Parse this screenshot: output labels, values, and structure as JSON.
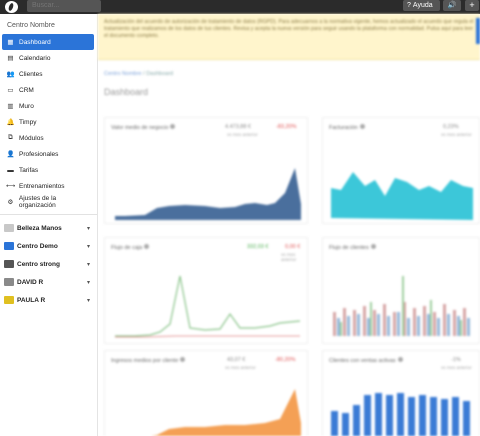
{
  "topbar": {
    "search_placeholder": "Buscar...",
    "help_label": "Ayuda",
    "sound_icon": "volume-icon",
    "plus_label": "+"
  },
  "sidebar": {
    "org_title": "Centro Nombre",
    "items": [
      {
        "label": "Dashboard",
        "icon": "dashboard-icon",
        "glyph": "▦",
        "active": true
      },
      {
        "label": "Calendario",
        "icon": "calendar-icon",
        "glyph": "▤"
      },
      {
        "label": "Clientes",
        "icon": "users-icon",
        "glyph": "👥"
      },
      {
        "label": "CRM",
        "icon": "crm-icon",
        "glyph": "▭"
      },
      {
        "label": "Muro",
        "icon": "wall-icon",
        "glyph": "▥"
      },
      {
        "label": "Timpy",
        "icon": "bell-icon",
        "glyph": "🔔"
      },
      {
        "label": "Módulos",
        "icon": "modules-icon",
        "glyph": "⧉"
      },
      {
        "label": "Profesionales",
        "icon": "professionals-icon",
        "glyph": "👤"
      },
      {
        "label": "Tarifas",
        "icon": "rates-icon",
        "glyph": "▬"
      },
      {
        "label": "Entrenamientos",
        "icon": "training-icon",
        "glyph": "⟷"
      },
      {
        "label": "Ajustes de la organización",
        "icon": "gear-icon",
        "glyph": "⚙"
      }
    ],
    "centers": [
      {
        "label": "Belleza Manos",
        "color": "#c8c8c8"
      },
      {
        "label": "Centro Demo",
        "color": "#2b74d8"
      },
      {
        "label": "Centro strong",
        "color": "#555555"
      },
      {
        "label": "DAVID R",
        "color": "#8a8a8a"
      },
      {
        "label": "PAULA R",
        "color": "#e0c020"
      }
    ]
  },
  "main": {
    "notice": "Actualización del acuerdo de autorización de tratamiento de datos (RGPD). Para adecuarnos a la normativa vigente, hemos actualizado el acuerdo que regula el tratamiento que realizamos de los datos de tus clientes. Revisa y acepta la nueva versión para seguir usando la plataforma con normalidad. Pulsa aquí para leer el documento completo.",
    "breadcrumb_1": "Centro Nombre",
    "breadcrumb_sep": "/",
    "breadcrumb_2": "Dashboard",
    "page_title": "Dashboard",
    "cards": {
      "c1": {
        "title": "Valor medio de negocio",
        "value": "4.473,88 €",
        "pct": "-83,20%",
        "sub": "vs mes anterior"
      },
      "c2": {
        "title": "Facturación",
        "value": "",
        "pct": "0,23%",
        "sub": "vs mes anterior"
      },
      "c3": {
        "title": "Flujo de caja",
        "value": "332,03 €",
        "pct": "0,00 €",
        "sub": "vs mes anterior"
      },
      "c4": {
        "title": "Flujo de clientes",
        "value": "",
        "pct": "",
        "sub": ""
      },
      "c5": {
        "title": "Ingresos medios por cliente",
        "value": "43,07 €",
        "pct": "-80,20%",
        "sub": "vs mes anterior"
      },
      "c6": {
        "title": "Clientes con ventas activas",
        "value": "",
        "pct": "-1%",
        "sub": "vs mes anterior"
      }
    }
  }
}
